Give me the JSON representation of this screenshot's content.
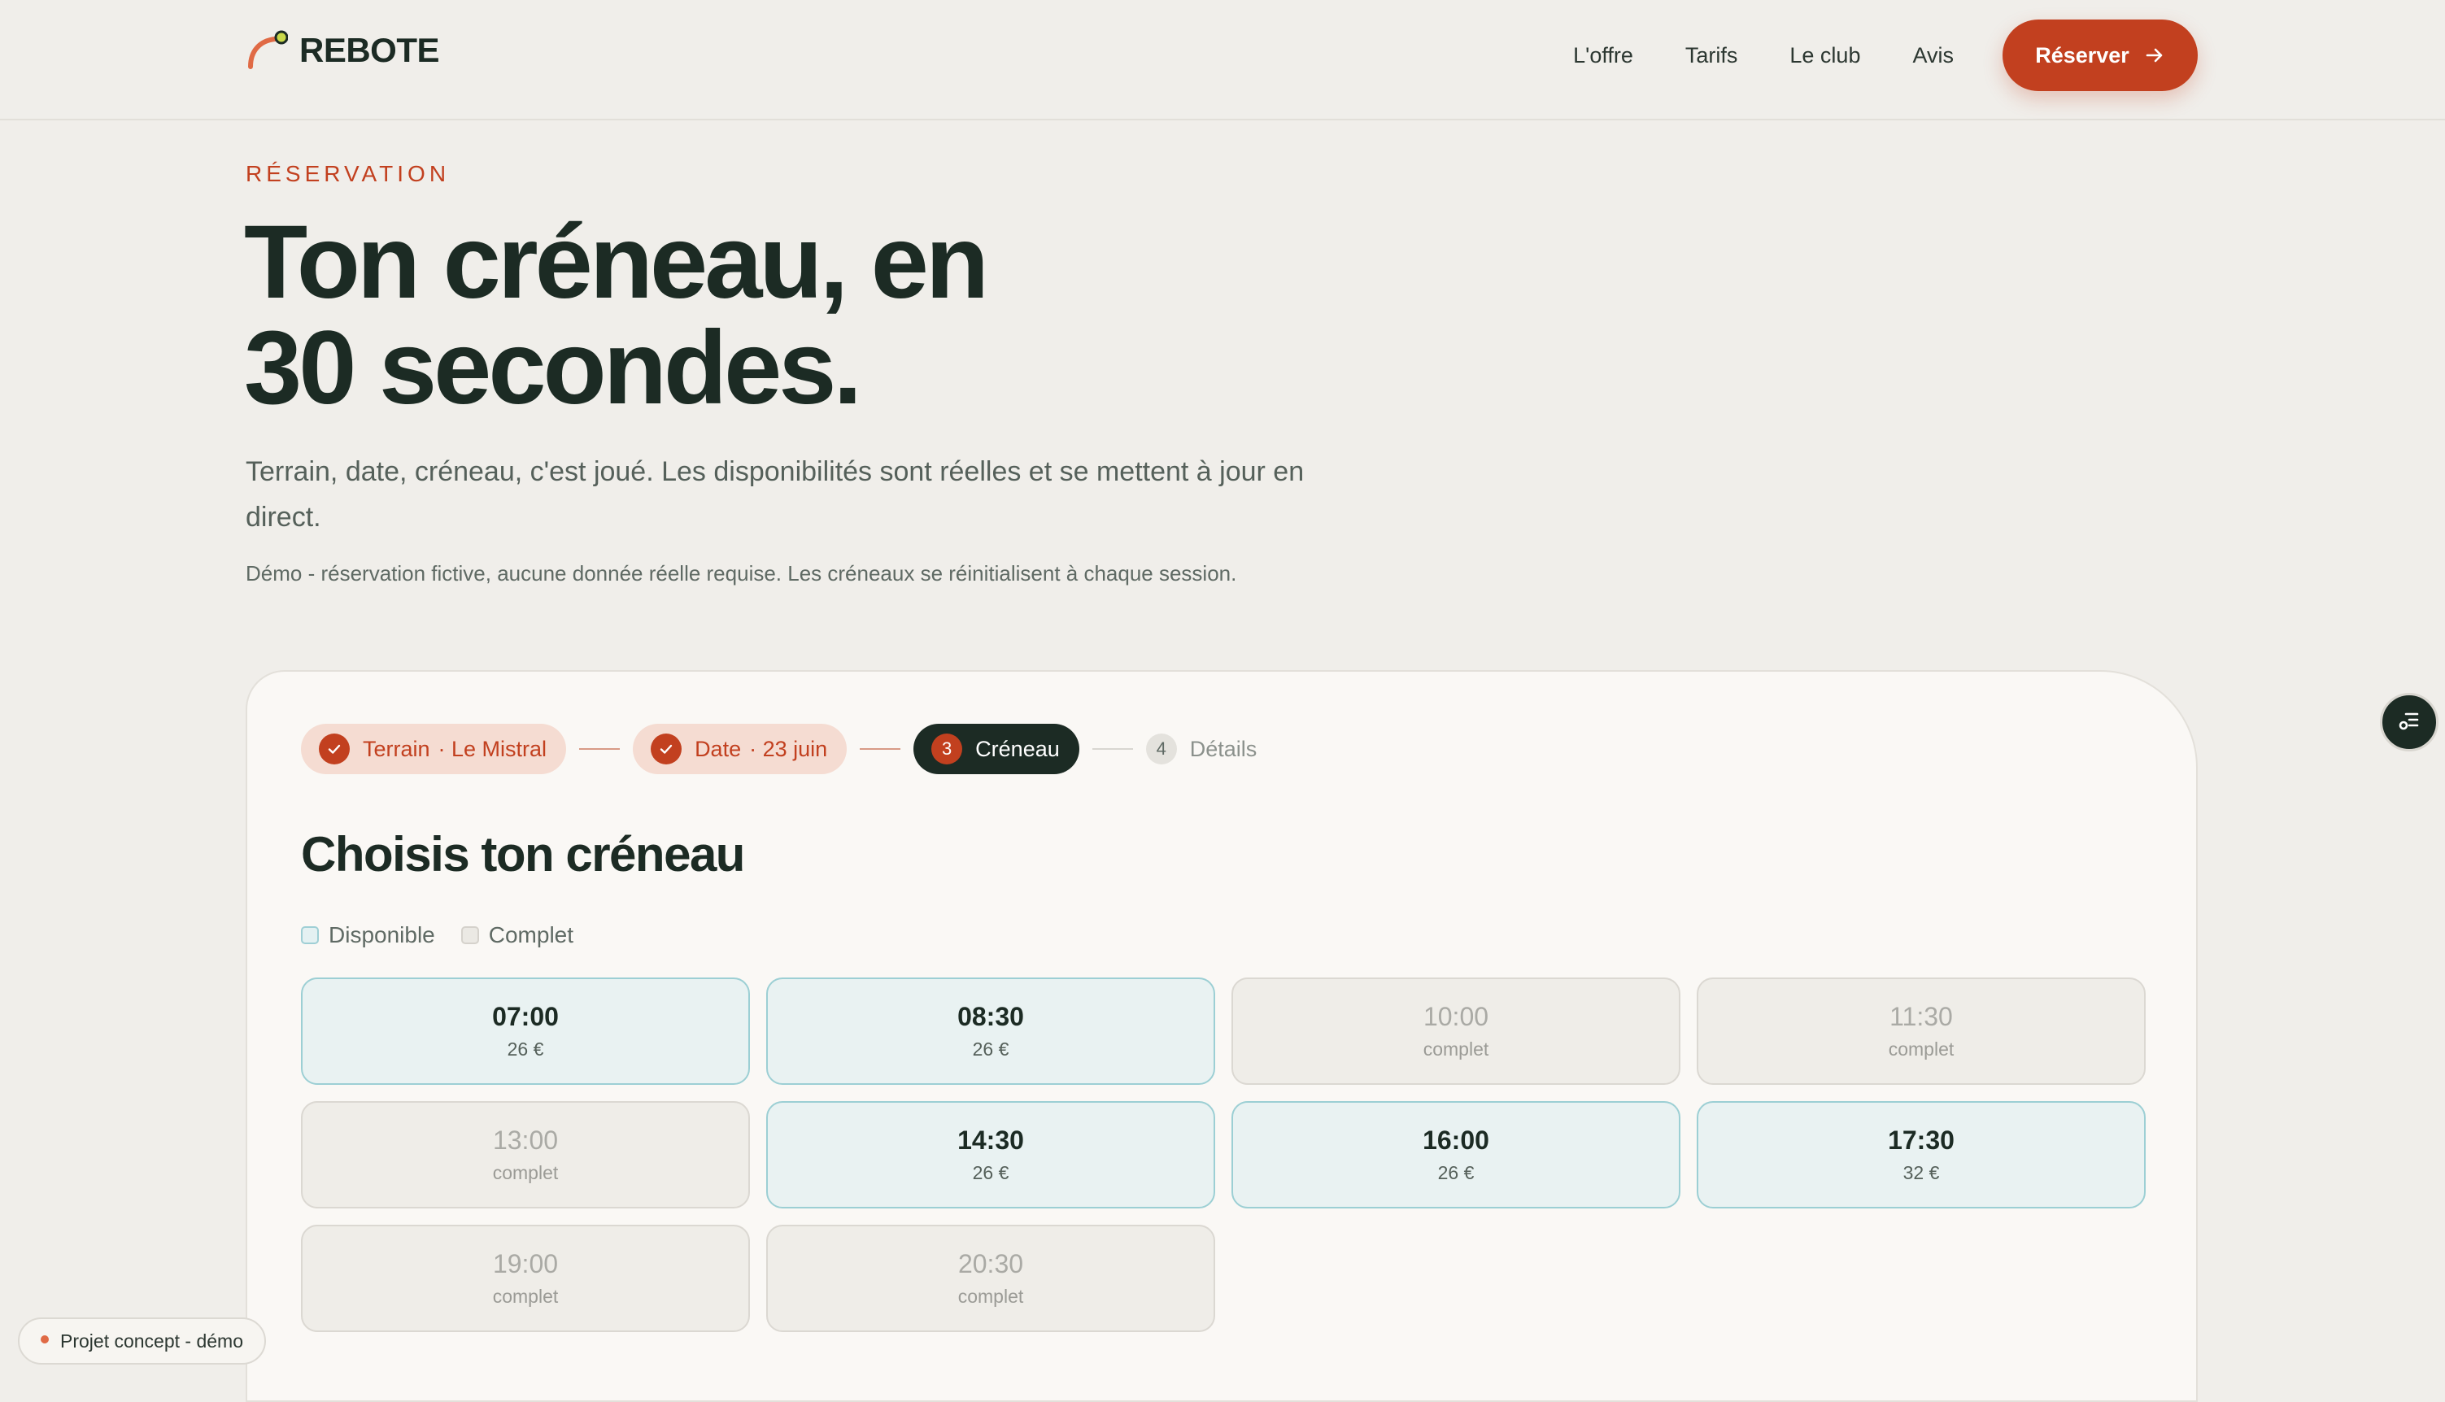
{
  "brand": {
    "name": "REBOTE"
  },
  "nav": {
    "items": [
      "L'offre",
      "Tarifs",
      "Le club",
      "Avis"
    ],
    "cta_label": "Réserver"
  },
  "hero": {
    "eyebrow": "RÉSERVATION",
    "title_line1": "Ton créneau, en",
    "title_line2": "30 secondes.",
    "lead": "Terrain, date, créneau, c'est joué. Les disponibilités sont réelles et se mettent à jour en direct.",
    "note": "Démo - réservation fictive, aucune donnée réelle requise. Les créneaux se réinitialisent à chaque session."
  },
  "steps": [
    {
      "status": "done",
      "label": "Terrain",
      "value": "· Le Mistral"
    },
    {
      "status": "done",
      "label": "Date",
      "value": "· 23 juin"
    },
    {
      "status": "active",
      "number": "3",
      "label": "Créneau"
    },
    {
      "status": "todo",
      "number": "4",
      "label": "Détails"
    }
  ],
  "booking": {
    "title": "Choisis ton créneau",
    "legend_available": "Disponible",
    "legend_full": "Complet"
  },
  "slots": [
    {
      "time": "07:00",
      "detail": "26 €",
      "status": "available"
    },
    {
      "time": "08:30",
      "detail": "26 €",
      "status": "available"
    },
    {
      "time": "10:00",
      "detail": "complet",
      "status": "full"
    },
    {
      "time": "11:30",
      "detail": "complet",
      "status": "full"
    },
    {
      "time": "13:00",
      "detail": "complet",
      "status": "full"
    },
    {
      "time": "14:30",
      "detail": "26 €",
      "status": "available"
    },
    {
      "time": "16:00",
      "detail": "26 €",
      "status": "available"
    },
    {
      "time": "17:30",
      "detail": "32 €",
      "status": "available"
    },
    {
      "time": "19:00",
      "detail": "complet",
      "status": "full"
    },
    {
      "time": "20:30",
      "detail": "complet",
      "status": "full"
    }
  ],
  "footer_tag": "Projet concept - démo",
  "colors": {
    "accent": "#c2401f",
    "ink": "#1c2b24",
    "available_bg": "#e9f2f2",
    "available_border": "#9ccfd4",
    "full_bg": "#efede8"
  },
  "icons": {
    "logo": "arc-logo-icon",
    "cta": "arrow-right-icon",
    "step_done": "check-icon",
    "fab": "menu-settings-icon"
  }
}
